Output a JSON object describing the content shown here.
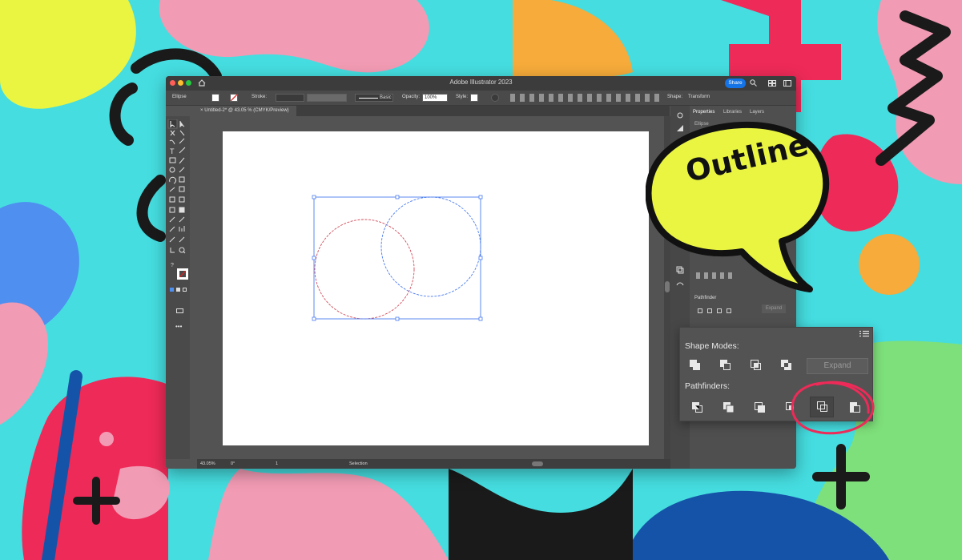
{
  "window": {
    "title": "Adobe Illustrator 2023",
    "share_label": "Share",
    "traffic_colors": [
      "#ff5f57",
      "#febc2e",
      "#28c840"
    ]
  },
  "control_bar": {
    "selection_type": "Ellipse",
    "stroke_label": "Stroke:",
    "brush_label": "Basic",
    "opacity_label": "Opacity:",
    "opacity_value": "100%",
    "style_label": "Style:",
    "shape_label": "Shape:",
    "transform_label": "Transform"
  },
  "document_tab": {
    "close_symbol": "×",
    "title": "Untitled-2* @ 43.05 % (CMYK/Preview)"
  },
  "status_bar": {
    "zoom": "43.05%",
    "rotation": "0°",
    "artboard_number": "1",
    "tool_name": "Selection"
  },
  "properties_panel": {
    "tabs": [
      "Properties",
      "Libraries",
      "Layers"
    ],
    "selection_label": "Ellipse",
    "pathfinder_section": "Pathfinder",
    "expand_label": "Expand"
  },
  "pathfinder_popup": {
    "shape_modes_label": "Shape Modes:",
    "expand_label": "Expand",
    "pathfinders_label": "Pathfinders:",
    "shape_modes": [
      "unite-icon",
      "minus-front-icon",
      "intersect-icon",
      "exclude-icon"
    ],
    "pathfinders": [
      "divide-icon",
      "trim-icon",
      "merge-icon",
      "crop-icon",
      "outline-icon",
      "minus-back-icon"
    ],
    "highlighted_tool": "outline-icon",
    "highlight_color": "#ee2a58"
  },
  "callout": {
    "text": "Outline",
    "bubble_color": "#eaf542"
  },
  "colors": {
    "background": "#45dde0",
    "accent_blue": "#1473e6",
    "selection_blue": "#4a7cf0",
    "path_red": "#d24b5a"
  }
}
